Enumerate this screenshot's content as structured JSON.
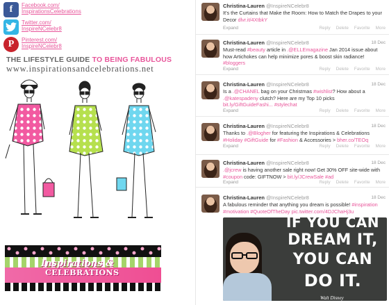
{
  "social": {
    "facebook": {
      "line1": "Facebook.com/",
      "line2": "InspirationsCelebrations"
    },
    "twitter": {
      "line1": "Twitter.com/",
      "line2": "InspireNCelebr8"
    },
    "pinterest": {
      "line1": "Pinterest.com/",
      "line2": "InspireNCelebr8"
    }
  },
  "tagline": {
    "part1": "THE LIFESTYLE GUIDE",
    "part2": "TO BEING FABULOUS"
  },
  "site_url": "www.inspirationsandcelebrations.net",
  "banner": {
    "line1": "Inspirations &",
    "line2": "CELEBRATIONS"
  },
  "colors": {
    "brand_pink": "#e8559a",
    "facebook_blue": "#3b5998",
    "twitter_blue": "#33b5e5",
    "pinterest_red": "#c8232c"
  },
  "tweets": [
    {
      "name": "Christina-Lauren",
      "handle": "@InspireNCelebr8",
      "date": "",
      "text_before": "It's the Curtains that Make the Room: How to Match the Drapes to your Decor ",
      "link": "dlvr.it/4XtbkY",
      "text_after": "",
      "expand": "Expand",
      "actions": [
        "Reply",
        "Delete",
        "Favorite",
        "More"
      ]
    },
    {
      "name": "Christina-Lauren",
      "handle": "@InspireNCelebr8",
      "date": "18 Dec",
      "segments": [
        "Must-read ",
        "#beauty",
        " article in ",
        ".@ELLEmagazine",
        " Jan 2014 issue about how Artichokes can help minimize pores & boost skin radiance! ",
        "#bloggers"
      ],
      "expand": "Expand",
      "actions": [
        "Reply",
        "Delete",
        "Favorite",
        "More"
      ]
    },
    {
      "name": "Christina-Lauren",
      "handle": "@InspireNCelebr8",
      "date": "18 Dec",
      "segments": [
        "Is a ",
        ".@CHANEL",
        " bag on your Christmas ",
        "#wishlist",
        "? How about a ",
        ".@katespadeny",
        " clutch? Here are my Top 10 picks ",
        "bit.ly/GiftGuideFashi...",
        " ",
        "#stylechat"
      ],
      "expand": "Expand",
      "actions": [
        "Reply",
        "Delete",
        "Favorite",
        "More"
      ]
    },
    {
      "name": "Christina-Lauren",
      "handle": "@InspireNCelebr8",
      "date": "18 Dec",
      "segments": [
        "Thanks to ",
        ".@Blogher",
        " for featuring the Inspirations & Celebrations ",
        "#Holiday",
        " ",
        "#GiftGuide",
        " for ",
        "#Fashion",
        " & Accessories > ",
        "bher.co/TEOq"
      ],
      "expand": "Expand",
      "actions": [
        "Reply",
        "Delete",
        "Favorite",
        "More"
      ]
    },
    {
      "name": "Christina-Lauren",
      "handle": "@InspireNCelebr8",
      "date": "18 Dec",
      "segments": [
        ".@jcrew",
        " is having another sale right now! Get 30% OFF site-wide with ",
        "#coupon",
        " code: GIFTNOW > ",
        "bit.ly/JCrewSale",
        " ",
        "#ad"
      ],
      "expand": "Expand",
      "actions": [
        "Reply",
        "Delete",
        "Favorite",
        "More"
      ]
    },
    {
      "name": "Christina-Lauren",
      "handle": "@InspireNCelebr8",
      "date": "18 Dec",
      "segments": [
        "A fabulous reminder that anything you dream is possible! ",
        "#inspiration",
        " ",
        "#motivation",
        " ",
        "#QuoteOfTheDay",
        " ",
        "pic.twitter.com/4DJChaHj3u"
      ],
      "expand": "Expand",
      "actions": []
    }
  ],
  "promo_image": {
    "lines": [
      "IF YOU CAN",
      "DREAM IT,",
      "YOU CAN",
      "DO IT."
    ],
    "author": "Walt Disney"
  }
}
